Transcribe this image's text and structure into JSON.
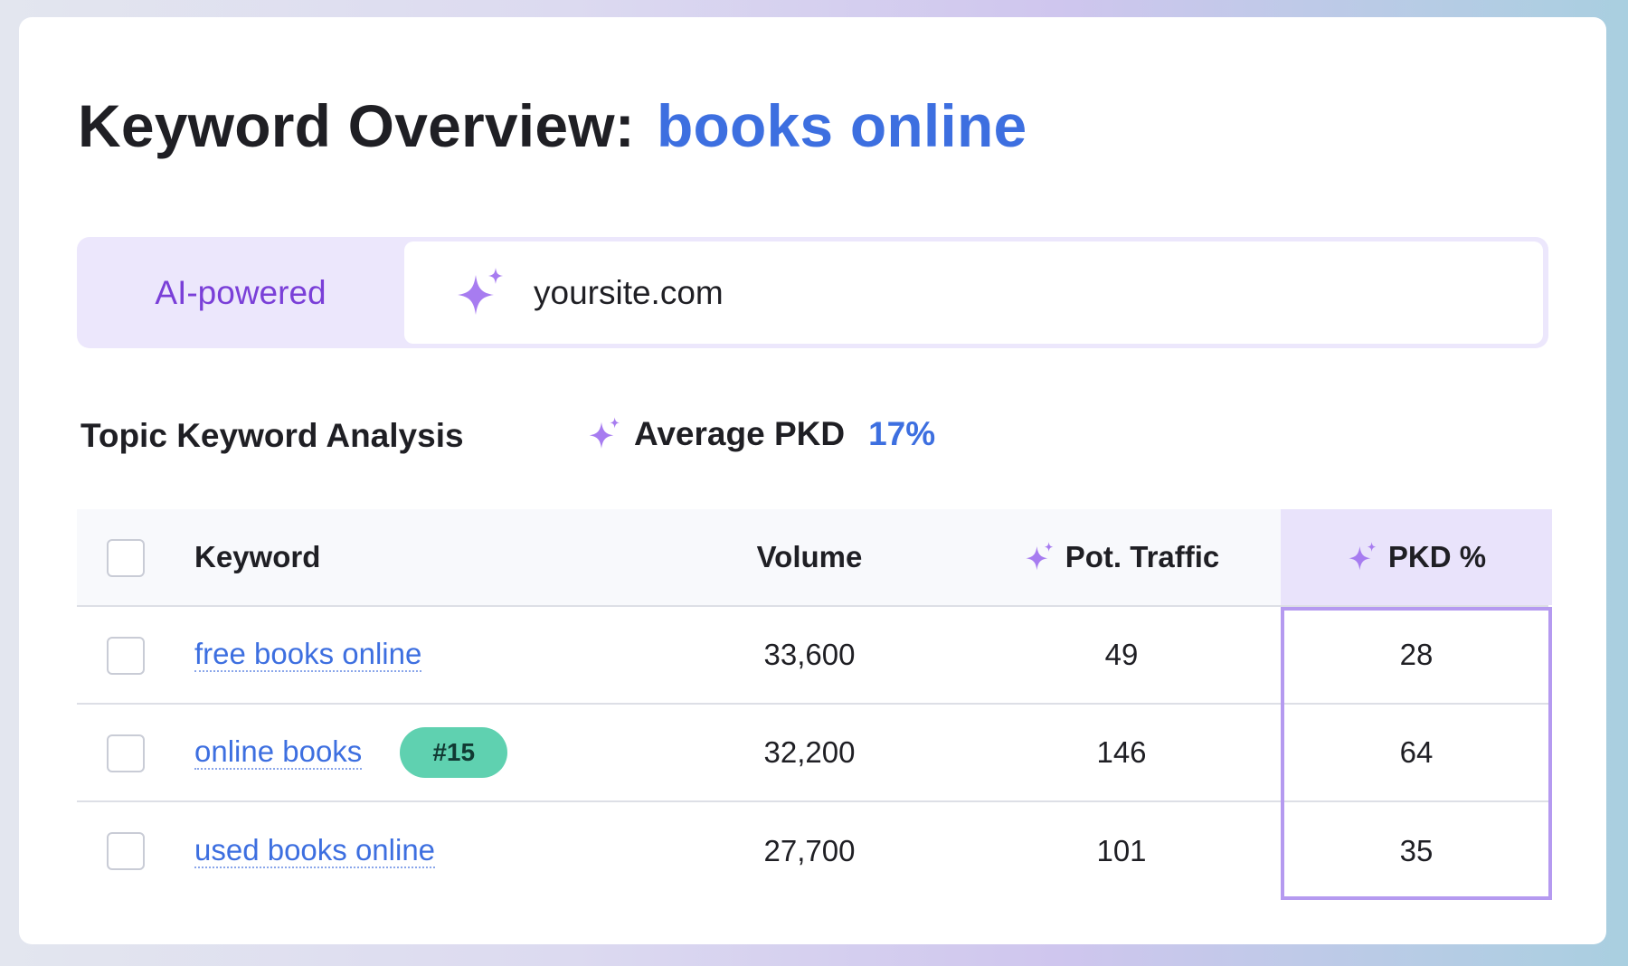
{
  "header": {
    "title_prefix": "Keyword Overview:",
    "keyword": "books online"
  },
  "ai_bar": {
    "label": "AI-powered",
    "icon": "sparkle-icon",
    "domain": "yoursite.com"
  },
  "analysis": {
    "title": "Topic Keyword Analysis",
    "avg_label": "Average PKD",
    "avg_value": "17%"
  },
  "table": {
    "columns": {
      "keyword": "Keyword",
      "volume": "Volume",
      "pot_traffic": "Pot. Traffic",
      "pkd": "PKD %"
    },
    "rows": [
      {
        "keyword": "free books online",
        "badge": "",
        "volume": "33,600",
        "pot_traffic": "49",
        "pkd": "28"
      },
      {
        "keyword": "online books",
        "badge": "#15",
        "volume": "32,200",
        "pot_traffic": "146",
        "pkd": "64"
      },
      {
        "keyword": "used books online",
        "badge": "",
        "volume": "27,700",
        "pot_traffic": "101",
        "pkd": "35"
      }
    ]
  },
  "colors": {
    "accent_blue": "#3d6fe0",
    "accent_purple": "#7a3fd8",
    "sparkle": "#a77cf0",
    "badge_green": "#5fd1b0",
    "highlight_border": "#b59af0"
  }
}
